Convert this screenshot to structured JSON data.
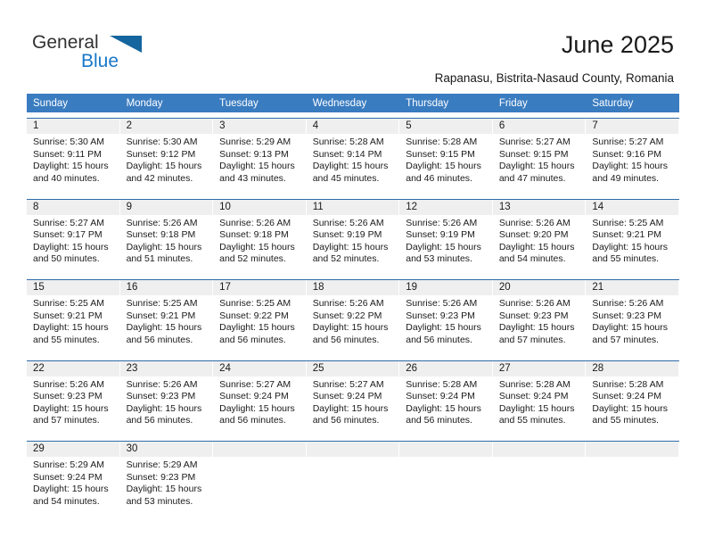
{
  "brand": {
    "name_part1": "General",
    "name_part2": "Blue",
    "triangle_icon": "triangle-icon",
    "accent_color": "#1878c8",
    "triangle_color": "#15659f"
  },
  "header": {
    "title": "June 2025",
    "subtitle": "Rapanasu, Bistrita-Nasaud County, Romania"
  },
  "calendar": {
    "header_bg": "#3a7cc0",
    "daynum_bg": "#efefef",
    "week_rule_color": "#2e6ca8",
    "weekdays": [
      "Sunday",
      "Monday",
      "Tuesday",
      "Wednesday",
      "Thursday",
      "Friday",
      "Saturday"
    ],
    "weeks": [
      [
        {
          "day": "1",
          "sunrise": "Sunrise: 5:30 AM",
          "sunset": "Sunset: 9:11 PM",
          "daylight1": "Daylight: 15 hours",
          "daylight2": "and 40 minutes."
        },
        {
          "day": "2",
          "sunrise": "Sunrise: 5:30 AM",
          "sunset": "Sunset: 9:12 PM",
          "daylight1": "Daylight: 15 hours",
          "daylight2": "and 42 minutes."
        },
        {
          "day": "3",
          "sunrise": "Sunrise: 5:29 AM",
          "sunset": "Sunset: 9:13 PM",
          "daylight1": "Daylight: 15 hours",
          "daylight2": "and 43 minutes."
        },
        {
          "day": "4",
          "sunrise": "Sunrise: 5:28 AM",
          "sunset": "Sunset: 9:14 PM",
          "daylight1": "Daylight: 15 hours",
          "daylight2": "and 45 minutes."
        },
        {
          "day": "5",
          "sunrise": "Sunrise: 5:28 AM",
          "sunset": "Sunset: 9:15 PM",
          "daylight1": "Daylight: 15 hours",
          "daylight2": "and 46 minutes."
        },
        {
          "day": "6",
          "sunrise": "Sunrise: 5:27 AM",
          "sunset": "Sunset: 9:15 PM",
          "daylight1": "Daylight: 15 hours",
          "daylight2": "and 47 minutes."
        },
        {
          "day": "7",
          "sunrise": "Sunrise: 5:27 AM",
          "sunset": "Sunset: 9:16 PM",
          "daylight1": "Daylight: 15 hours",
          "daylight2": "and 49 minutes."
        }
      ],
      [
        {
          "day": "8",
          "sunrise": "Sunrise: 5:27 AM",
          "sunset": "Sunset: 9:17 PM",
          "daylight1": "Daylight: 15 hours",
          "daylight2": "and 50 minutes."
        },
        {
          "day": "9",
          "sunrise": "Sunrise: 5:26 AM",
          "sunset": "Sunset: 9:18 PM",
          "daylight1": "Daylight: 15 hours",
          "daylight2": "and 51 minutes."
        },
        {
          "day": "10",
          "sunrise": "Sunrise: 5:26 AM",
          "sunset": "Sunset: 9:18 PM",
          "daylight1": "Daylight: 15 hours",
          "daylight2": "and 52 minutes."
        },
        {
          "day": "11",
          "sunrise": "Sunrise: 5:26 AM",
          "sunset": "Sunset: 9:19 PM",
          "daylight1": "Daylight: 15 hours",
          "daylight2": "and 52 minutes."
        },
        {
          "day": "12",
          "sunrise": "Sunrise: 5:26 AM",
          "sunset": "Sunset: 9:19 PM",
          "daylight1": "Daylight: 15 hours",
          "daylight2": "and 53 minutes."
        },
        {
          "day": "13",
          "sunrise": "Sunrise: 5:26 AM",
          "sunset": "Sunset: 9:20 PM",
          "daylight1": "Daylight: 15 hours",
          "daylight2": "and 54 minutes."
        },
        {
          "day": "14",
          "sunrise": "Sunrise: 5:25 AM",
          "sunset": "Sunset: 9:21 PM",
          "daylight1": "Daylight: 15 hours",
          "daylight2": "and 55 minutes."
        }
      ],
      [
        {
          "day": "15",
          "sunrise": "Sunrise: 5:25 AM",
          "sunset": "Sunset: 9:21 PM",
          "daylight1": "Daylight: 15 hours",
          "daylight2": "and 55 minutes."
        },
        {
          "day": "16",
          "sunrise": "Sunrise: 5:25 AM",
          "sunset": "Sunset: 9:21 PM",
          "daylight1": "Daylight: 15 hours",
          "daylight2": "and 56 minutes."
        },
        {
          "day": "17",
          "sunrise": "Sunrise: 5:25 AM",
          "sunset": "Sunset: 9:22 PM",
          "daylight1": "Daylight: 15 hours",
          "daylight2": "and 56 minutes."
        },
        {
          "day": "18",
          "sunrise": "Sunrise: 5:26 AM",
          "sunset": "Sunset: 9:22 PM",
          "daylight1": "Daylight: 15 hours",
          "daylight2": "and 56 minutes."
        },
        {
          "day": "19",
          "sunrise": "Sunrise: 5:26 AM",
          "sunset": "Sunset: 9:23 PM",
          "daylight1": "Daylight: 15 hours",
          "daylight2": "and 56 minutes."
        },
        {
          "day": "20",
          "sunrise": "Sunrise: 5:26 AM",
          "sunset": "Sunset: 9:23 PM",
          "daylight1": "Daylight: 15 hours",
          "daylight2": "and 57 minutes."
        },
        {
          "day": "21",
          "sunrise": "Sunrise: 5:26 AM",
          "sunset": "Sunset: 9:23 PM",
          "daylight1": "Daylight: 15 hours",
          "daylight2": "and 57 minutes."
        }
      ],
      [
        {
          "day": "22",
          "sunrise": "Sunrise: 5:26 AM",
          "sunset": "Sunset: 9:23 PM",
          "daylight1": "Daylight: 15 hours",
          "daylight2": "and 57 minutes."
        },
        {
          "day": "23",
          "sunrise": "Sunrise: 5:26 AM",
          "sunset": "Sunset: 9:23 PM",
          "daylight1": "Daylight: 15 hours",
          "daylight2": "and 56 minutes."
        },
        {
          "day": "24",
          "sunrise": "Sunrise: 5:27 AM",
          "sunset": "Sunset: 9:24 PM",
          "daylight1": "Daylight: 15 hours",
          "daylight2": "and 56 minutes."
        },
        {
          "day": "25",
          "sunrise": "Sunrise: 5:27 AM",
          "sunset": "Sunset: 9:24 PM",
          "daylight1": "Daylight: 15 hours",
          "daylight2": "and 56 minutes."
        },
        {
          "day": "26",
          "sunrise": "Sunrise: 5:28 AM",
          "sunset": "Sunset: 9:24 PM",
          "daylight1": "Daylight: 15 hours",
          "daylight2": "and 56 minutes."
        },
        {
          "day": "27",
          "sunrise": "Sunrise: 5:28 AM",
          "sunset": "Sunset: 9:24 PM",
          "daylight1": "Daylight: 15 hours",
          "daylight2": "and 55 minutes."
        },
        {
          "day": "28",
          "sunrise": "Sunrise: 5:28 AM",
          "sunset": "Sunset: 9:24 PM",
          "daylight1": "Daylight: 15 hours",
          "daylight2": "and 55 minutes."
        }
      ],
      [
        {
          "day": "29",
          "sunrise": "Sunrise: 5:29 AM",
          "sunset": "Sunset: 9:24 PM",
          "daylight1": "Daylight: 15 hours",
          "daylight2": "and 54 minutes."
        },
        {
          "day": "30",
          "sunrise": "Sunrise: 5:29 AM",
          "sunset": "Sunset: 9:23 PM",
          "daylight1": "Daylight: 15 hours",
          "daylight2": "and 53 minutes."
        },
        {
          "day": "",
          "sunrise": "",
          "sunset": "",
          "daylight1": "",
          "daylight2": ""
        },
        {
          "day": "",
          "sunrise": "",
          "sunset": "",
          "daylight1": "",
          "daylight2": ""
        },
        {
          "day": "",
          "sunrise": "",
          "sunset": "",
          "daylight1": "",
          "daylight2": ""
        },
        {
          "day": "",
          "sunrise": "",
          "sunset": "",
          "daylight1": "",
          "daylight2": ""
        },
        {
          "day": "",
          "sunrise": "",
          "sunset": "",
          "daylight1": "",
          "daylight2": ""
        }
      ]
    ]
  }
}
